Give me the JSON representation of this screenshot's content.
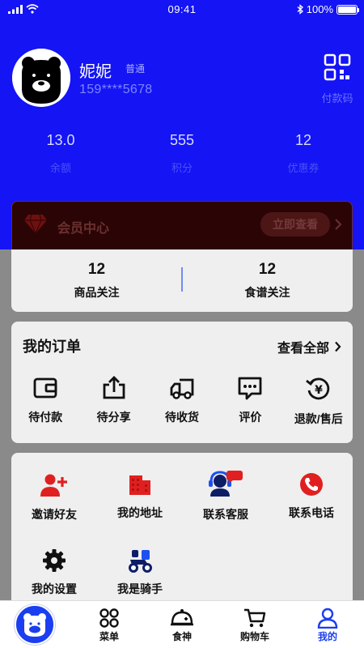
{
  "status_bar": {
    "time": "09:41",
    "battery": "100%",
    "battery_level": 1.0
  },
  "profile": {
    "name": "妮妮",
    "level": "普通",
    "phone": "159****5678",
    "paycode_label": "付款码"
  },
  "stats": [
    {
      "value": "13.0",
      "label": "余额"
    },
    {
      "value": "555",
      "label": "积分"
    },
    {
      "value": "12",
      "label": "优惠券"
    }
  ],
  "member": {
    "title": "会员中心",
    "button": "立即查看"
  },
  "follow": [
    {
      "num": "12",
      "label": "商品关注"
    },
    {
      "num": "12",
      "label": "食谱关注"
    }
  ],
  "orders": {
    "title": "我的订单",
    "view_all": "查看全部",
    "items": [
      {
        "label": "待付款",
        "icon": "wallet-icon"
      },
      {
        "label": "待分享",
        "icon": "share-icon"
      },
      {
        "label": "待收货",
        "icon": "truck-icon"
      },
      {
        "label": "评价",
        "icon": "comment-icon"
      },
      {
        "label": "退款/售后",
        "icon": "refund-icon"
      }
    ]
  },
  "services": [
    {
      "label": "邀请好友",
      "icon": "add-user-icon"
    },
    {
      "label": "我的地址",
      "icon": "building-icon"
    },
    {
      "label": "联系客服",
      "icon": "customer-service-icon"
    },
    {
      "label": "联系电话",
      "icon": "phone-icon"
    },
    {
      "label": "我的设置",
      "icon": "gear-icon"
    },
    {
      "label": "我是骑手",
      "icon": "rider-icon"
    }
  ],
  "tabbar": [
    {
      "label": "",
      "icon": "bear-logo-icon"
    },
    {
      "label": "菜单",
      "icon": "menu-icon"
    },
    {
      "label": "食神",
      "icon": "chef-hat-icon"
    },
    {
      "label": "购物车",
      "icon": "cart-icon"
    },
    {
      "label": "我的",
      "icon": "user-icon"
    }
  ],
  "colors": {
    "header": "#1414f5",
    "accent_red": "#e02020",
    "active_tab": "#1a3ef0"
  }
}
